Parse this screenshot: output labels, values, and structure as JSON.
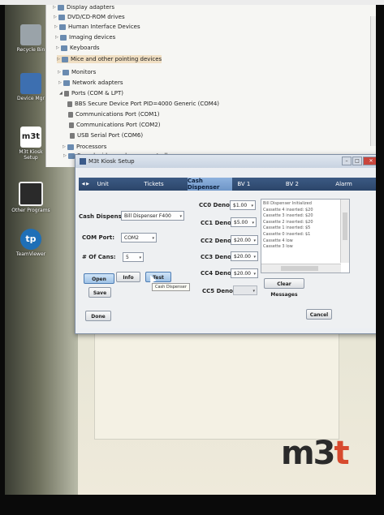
{
  "devmgr": {
    "items": [
      {
        "label": "Display adapters",
        "exp": "▷"
      },
      {
        "label": "DVD/CD-ROM drives",
        "exp": "▷"
      },
      {
        "label": "Human Interface Devices",
        "exp": "▷"
      },
      {
        "label": "Imaging devices",
        "exp": "▷"
      },
      {
        "label": "Keyboards",
        "exp": "▷"
      },
      {
        "label": "Mice and other pointing devices",
        "exp": "▷"
      },
      {
        "label": "Monitors",
        "exp": "▷"
      },
      {
        "label": "Network adapters",
        "exp": "▷"
      },
      {
        "label": "Ports (COM & LPT)",
        "exp": "◢"
      },
      {
        "label": "BBS Secure Device Port PID=4000 Generic (COM4)",
        "exp": ""
      },
      {
        "label": "Communications Port (COM1)",
        "exp": ""
      },
      {
        "label": "Communications Port (COM2)",
        "exp": ""
      },
      {
        "label": "USB Serial Port (COM6)",
        "exp": ""
      },
      {
        "label": "Processors",
        "exp": "▷"
      },
      {
        "label": "Sound, video and game controllers",
        "exp": "▷"
      }
    ]
  },
  "desktop": {
    "icons": [
      {
        "label": "Recycle Bin"
      },
      {
        "label": "Device Mgr"
      },
      {
        "label": "M3t Kiosk Setup"
      },
      {
        "label": "Other Programs"
      },
      {
        "label": "TeamViewer"
      }
    ]
  },
  "window": {
    "title": "M3t Kiosk Setup",
    "close_glyph": "✕",
    "min_glyph": "–",
    "max_glyph": "□",
    "nav_glyph": "◀ ▶",
    "tabs": [
      "Unit",
      "Tickets",
      "Cash Dispenser",
      "BV 1",
      "BV 2",
      "Alarm"
    ],
    "active_tab": "Cash Dispenser"
  },
  "form": {
    "dispenser_label": "Cash Dispenser:",
    "dispenser_value": "Bill Dispenser F400",
    "com_label": "COM Port:",
    "com_value": "COM2",
    "cans_label": "# Of Cans:",
    "cans_value": "5",
    "denoms": [
      {
        "label": "CC0 Denom:",
        "value": "$1.00"
      },
      {
        "label": "CC1 Denom:",
        "value": "$5.00"
      },
      {
        "label": "CC2 Denom:",
        "value": "$20.00"
      },
      {
        "label": "CC3 Denom:",
        "value": "$20.00"
      },
      {
        "label": "CC4 Denom:",
        "value": "$20.00"
      },
      {
        "label": "CC5 Denom:",
        "value": ""
      }
    ],
    "open_label": "Open",
    "info_label": "Info",
    "test_label": "Test",
    "save_label": "Save",
    "clear_label": "Clear Messages",
    "tooltip": "Cash Dispenser",
    "done_label": "Done",
    "cancel_label": "Cancel"
  },
  "messages": [
    "Bill Dispenser Initialized",
    "Cassette 4 inserted: $20",
    "Cassette 3 inserted: $20",
    "Cassette 2 inserted: $20",
    "Cassette 1 inserted: $5",
    "Cassette 0 inserted: $1",
    "Cassette 4 low",
    "Cassette 3 low"
  ],
  "logo": {
    "main": "m3",
    "accent": "t"
  },
  "colors": {
    "tab_bar": "#2b456a",
    "active_tab": "#8eb2de",
    "logo_accent": "#d74a2e"
  }
}
